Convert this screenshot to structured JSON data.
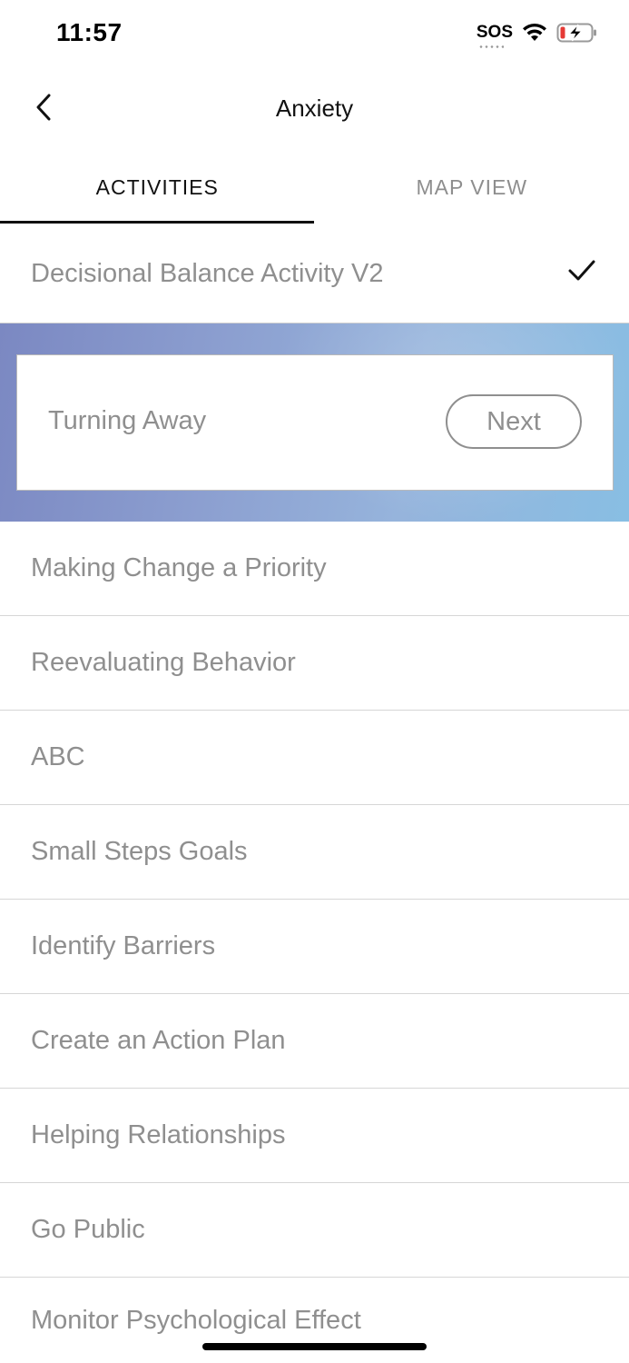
{
  "status_bar": {
    "time": "11:57",
    "sos": "SOS",
    "icons": [
      "wifi-icon",
      "battery-charging-icon"
    ]
  },
  "nav": {
    "title": "Anxiety",
    "back_icon": "chevron-left-icon"
  },
  "tabs": [
    {
      "label": "ACTIVITIES",
      "active": true
    },
    {
      "label": "MAP VIEW",
      "active": false
    }
  ],
  "completed_item": {
    "label": "Decisional Balance Activity V2",
    "status_icon": "checkmark-icon"
  },
  "current_activity": {
    "label": "Turning Away",
    "button_label": "Next"
  },
  "activities": [
    {
      "label": "Making Change a Priority"
    },
    {
      "label": "Reevaluating Behavior"
    },
    {
      "label": "ABC"
    },
    {
      "label": "Small Steps Goals"
    },
    {
      "label": "Identify Barriers"
    },
    {
      "label": "Create an Action Plan"
    },
    {
      "label": "Helping Relationships"
    },
    {
      "label": "Go Public"
    },
    {
      "label": "Monitor Psychological Effect"
    }
  ],
  "colors": {
    "text_muted": "#8f8f8f",
    "divider": "#d6d6d6",
    "banner_gradient_start": "#7b88c2",
    "banner_gradient_end": "#88bee3",
    "battery_low": "#e53935"
  }
}
